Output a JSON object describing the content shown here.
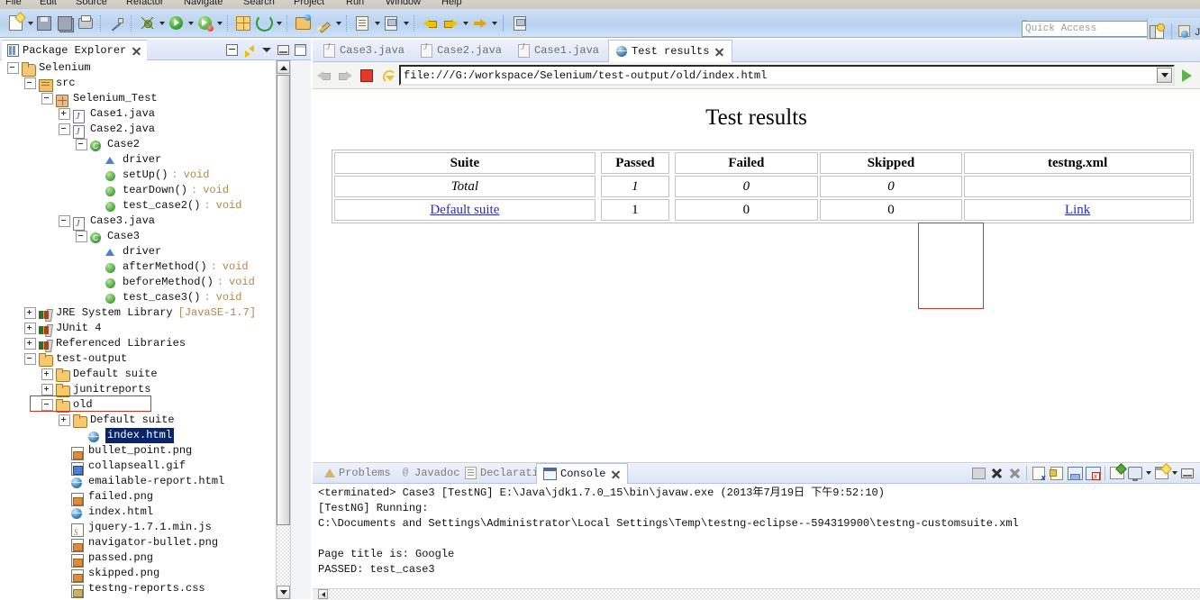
{
  "menubar": {
    "items": [
      "File",
      "Edit",
      "Source",
      "Refactor",
      "Navigate",
      "Search",
      "Project",
      "Run",
      "Window",
      "Help"
    ]
  },
  "toolbar": {
    "quick_access_placeholder": "Quick Access",
    "buttons": [
      {
        "name": "new-wizard",
        "label": "New"
      },
      {
        "name": "save",
        "label": "Save"
      },
      {
        "name": "save-all",
        "label": "Save All"
      },
      {
        "name": "print",
        "label": "Print"
      },
      {
        "name": "toggle-mark-occurrences",
        "label": "Toggle Mark Occurrences"
      },
      {
        "name": "debug",
        "label": "Debug"
      },
      {
        "name": "run",
        "label": "Run"
      },
      {
        "name": "run-coverage",
        "label": "Coverage"
      },
      {
        "name": "new-java-package",
        "label": "New Java Package"
      },
      {
        "name": "external-tools",
        "label": "External Tools"
      },
      {
        "name": "open-type",
        "label": "Open Type"
      },
      {
        "name": "search",
        "label": "Search"
      },
      {
        "name": "next-annotation",
        "label": "Next Annotation"
      },
      {
        "name": "previous-annotation",
        "label": "Previous Annotation"
      },
      {
        "name": "back",
        "label": "Back"
      },
      {
        "name": "forward",
        "label": "Forward"
      },
      {
        "name": "forward-to",
        "label": "Forward To"
      },
      {
        "name": "pin-editor",
        "label": "Pin Editor"
      }
    ],
    "perspective_label": "J"
  },
  "package_explorer": {
    "title": "Package Explorer",
    "tools": [
      {
        "name": "collapse-all",
        "label": "Collapse All"
      },
      {
        "name": "link-with-editor",
        "label": "Link with Editor"
      },
      {
        "name": "view-menu",
        "label": "View Menu"
      },
      {
        "name": "minimize",
        "label": "Minimize"
      },
      {
        "name": "maximize",
        "label": "Maximize"
      }
    ],
    "tree": [
      {
        "label": "Selenium",
        "indent": 0,
        "expander": "minus",
        "icon": "project"
      },
      {
        "label": "src",
        "indent": 1,
        "expander": "minus",
        "icon": "srcfolder"
      },
      {
        "label": "Selenium_Test",
        "indent": 2,
        "expander": "minus",
        "icon": "package"
      },
      {
        "label": "Case1.java",
        "indent": 3,
        "expander": "plus",
        "icon": "java"
      },
      {
        "label": "Case2.java",
        "indent": 3,
        "expander": "minus",
        "icon": "java"
      },
      {
        "label": "Case2",
        "indent": 4,
        "expander": "minus",
        "icon": "class"
      },
      {
        "label": "driver",
        "indent": 5,
        "expander": "none",
        "icon": "field"
      },
      {
        "label": "setUp()",
        "indent": 5,
        "expander": "none",
        "icon": "method",
        "meta": "void"
      },
      {
        "label": "tearDown()",
        "indent": 5,
        "expander": "none",
        "icon": "method",
        "meta": "void"
      },
      {
        "label": "test_case2()",
        "indent": 5,
        "expander": "none",
        "icon": "method",
        "meta": "void"
      },
      {
        "label": "Case3.java",
        "indent": 3,
        "expander": "minus",
        "icon": "java"
      },
      {
        "label": "Case3",
        "indent": 4,
        "expander": "minus",
        "icon": "class"
      },
      {
        "label": "driver",
        "indent": 5,
        "expander": "none",
        "icon": "field"
      },
      {
        "label": "afterMethod()",
        "indent": 5,
        "expander": "none",
        "icon": "method",
        "meta": "void"
      },
      {
        "label": "beforeMethod()",
        "indent": 5,
        "expander": "none",
        "icon": "method",
        "meta": "void"
      },
      {
        "label": "test_case3()",
        "indent": 5,
        "expander": "none",
        "icon": "method",
        "meta": "void"
      },
      {
        "label": "JRE System Library",
        "indent": 1,
        "expander": "plus",
        "icon": "library",
        "meta2": "[JavaSE-1.7]"
      },
      {
        "label": "JUnit 4",
        "indent": 1,
        "expander": "plus",
        "icon": "library"
      },
      {
        "label": "Referenced Libraries",
        "indent": 1,
        "expander": "plus",
        "icon": "library"
      },
      {
        "label": "test-output",
        "indent": 1,
        "expander": "minus",
        "icon": "folder",
        "highlight_box": true
      },
      {
        "label": "Default suite",
        "indent": 2,
        "expander": "plus",
        "icon": "folder"
      },
      {
        "label": "junitreports",
        "indent": 2,
        "expander": "plus",
        "icon": "folder"
      },
      {
        "label": "old",
        "indent": 2,
        "expander": "minus",
        "icon": "folder"
      },
      {
        "label": "Default suite",
        "indent": 3,
        "expander": "plus",
        "icon": "folder"
      },
      {
        "label": "index.html",
        "indent": 4,
        "expander": "none",
        "icon": "html",
        "selected": true
      },
      {
        "label": "bullet_point.png",
        "indent": 3,
        "expander": "none",
        "icon": "png"
      },
      {
        "label": "collapseall.gif",
        "indent": 3,
        "expander": "none",
        "icon": "gif"
      },
      {
        "label": "emailable-report.html",
        "indent": 3,
        "expander": "none",
        "icon": "html"
      },
      {
        "label": "failed.png",
        "indent": 3,
        "expander": "none",
        "icon": "png"
      },
      {
        "label": "index.html",
        "indent": 3,
        "expander": "none",
        "icon": "html"
      },
      {
        "label": "jquery-1.7.1.min.js",
        "indent": 3,
        "expander": "none",
        "icon": "js"
      },
      {
        "label": "navigator-bullet.png",
        "indent": 3,
        "expander": "none",
        "icon": "png"
      },
      {
        "label": "passed.png",
        "indent": 3,
        "expander": "none",
        "icon": "png"
      },
      {
        "label": "skipped.png",
        "indent": 3,
        "expander": "none",
        "icon": "png"
      },
      {
        "label": "testng-reports.css",
        "indent": 3,
        "expander": "none",
        "icon": "css"
      }
    ]
  },
  "editor": {
    "tabs": [
      {
        "label": "Case3.java",
        "icon": "java-file-icon",
        "active": false,
        "closable": false
      },
      {
        "label": "Case2.java",
        "icon": "java-file-icon",
        "active": false,
        "closable": false
      },
      {
        "label": "Case1.java",
        "icon": "java-file-icon",
        "active": false,
        "closable": false
      },
      {
        "label": "Test results",
        "icon": "web-browser-icon",
        "active": true,
        "closable": true
      }
    ],
    "browser": {
      "url": "file:///G:/workspace/Selenium/test-output/old/index.html",
      "back_label": "Back",
      "forward_label": "Forward",
      "stop_label": "Stop",
      "refresh_label": "Refresh",
      "go_label": "Go"
    }
  },
  "report": {
    "title": "Test results",
    "columns": [
      "Suite",
      "Passed",
      "Failed",
      "Skipped",
      "testng.xml"
    ],
    "rows": [
      {
        "suite": "Total",
        "passed": "1",
        "failed": "0",
        "skipped": "0",
        "xml": "",
        "italic": true,
        "link": false
      },
      {
        "suite": "Default suite",
        "passed": "1",
        "failed": "0",
        "skipped": "0",
        "xml": "Link",
        "italic": false,
        "link": true
      }
    ],
    "highlight_color": "#c0392b"
  },
  "console": {
    "tabs": [
      {
        "label": "Problems",
        "icon": "warning-icon",
        "active": false,
        "closable": false
      },
      {
        "label": "Javadoc",
        "icon": "at-icon",
        "active": false,
        "closable": false
      },
      {
        "label": "Declaration",
        "icon": "declaration-icon",
        "active": false,
        "closable": false
      },
      {
        "label": "Console",
        "icon": "console-icon",
        "active": true,
        "closable": true
      }
    ],
    "tools": [
      {
        "name": "scroll-lock",
        "label": "Scroll Lock"
      },
      {
        "name": "terminate",
        "label": "Terminate"
      },
      {
        "name": "remove-all-terminated",
        "label": "Remove All Terminated Launches"
      },
      {
        "name": "clear-console",
        "label": "Clear Console"
      },
      {
        "name": "lock-scroll",
        "label": "Scroll Lock"
      },
      {
        "name": "pin-console",
        "label": "Pin Console"
      },
      {
        "name": "close-console",
        "label": "Close Console"
      },
      {
        "name": "open-console",
        "label": "Open Console"
      },
      {
        "name": "display-selected-console",
        "label": "Display Selected Console"
      },
      {
        "name": "new-console-view",
        "label": "New Console View"
      },
      {
        "name": "minimize-console",
        "label": "Minimize"
      }
    ],
    "lines": [
      "<terminated> Case3 [TestNG] E:\\Java\\jdk1.7.0_15\\bin\\javaw.exe (2013年7月19日 下午9:52:10)",
      "[TestNG] Running:",
      "  C:\\Documents and Settings\\Administrator\\Local Settings\\Temp\\testng-eclipse--594319900\\testng-customsuite.xml",
      "",
      "Page title is: Google",
      "PASSED: test_case3"
    ]
  }
}
